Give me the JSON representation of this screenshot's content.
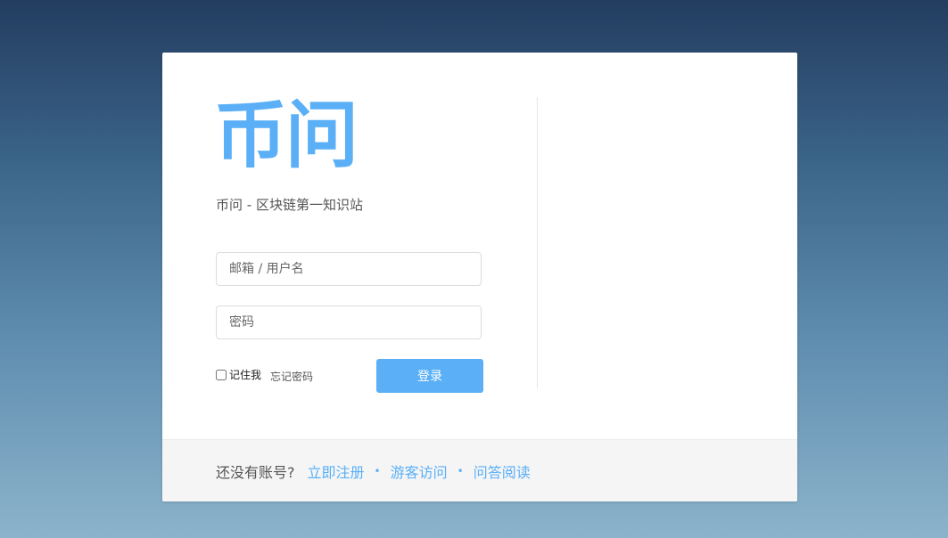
{
  "brand": {
    "logo_text": "币问",
    "tagline": "币问 - 区块链第一知识站"
  },
  "form": {
    "username_placeholder": "邮箱 / 用户名",
    "password_placeholder": "密码",
    "remember_label": "记住我",
    "forgot_label": "忘记密码",
    "login_label": "登录"
  },
  "footer": {
    "prompt": "还没有账号?",
    "links": [
      {
        "label": "立即注册"
      },
      {
        "label": "游客访问"
      },
      {
        "label": "问答阅读"
      }
    ],
    "separator": "•"
  },
  "colors": {
    "accent": "#5aaff7",
    "link": "#5aaff7"
  }
}
